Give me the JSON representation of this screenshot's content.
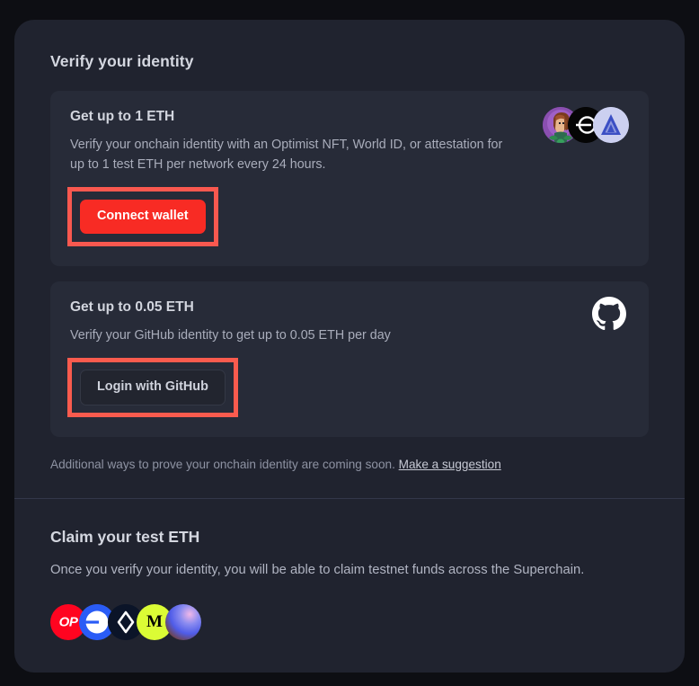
{
  "verify_section": {
    "title": "Verify your identity",
    "cards": [
      {
        "title": "Get up to 1 ETH",
        "description": "Verify your onchain identity with an Optimist NFT, World ID, or attestation for up to 1 test ETH per network every 24 hours.",
        "button_label": "Connect wallet",
        "icons": [
          "optimist-nft-icon",
          "world-id-icon",
          "attestation-eas-icon"
        ]
      },
      {
        "title": "Get up to 0.05 ETH",
        "description": "Verify your GitHub identity to get up to 0.05 ETH per day",
        "button_label": "Login with GitHub",
        "icons": [
          "github-icon"
        ]
      }
    ],
    "note_text": "Additional ways to prove your onchain identity are coming soon.",
    "note_link": "Make a suggestion"
  },
  "claim_section": {
    "title": "Claim your test ETH",
    "description": "Once you verify your identity, you will be able to claim testnet funds across the Superchain.",
    "chains": [
      {
        "name": "optimism",
        "label": "OP"
      },
      {
        "name": "base",
        "label": ""
      },
      {
        "name": "lisk",
        "label": ""
      },
      {
        "name": "mode",
        "label": "M"
      },
      {
        "name": "zora",
        "label": ""
      }
    ]
  },
  "colors": {
    "page_background": "#0d0e13",
    "panel_background": "#20232f",
    "card_background": "#272b38",
    "primary_button": "#f82b24",
    "highlight_outline": "#f9584f",
    "divider": "#33374a"
  }
}
